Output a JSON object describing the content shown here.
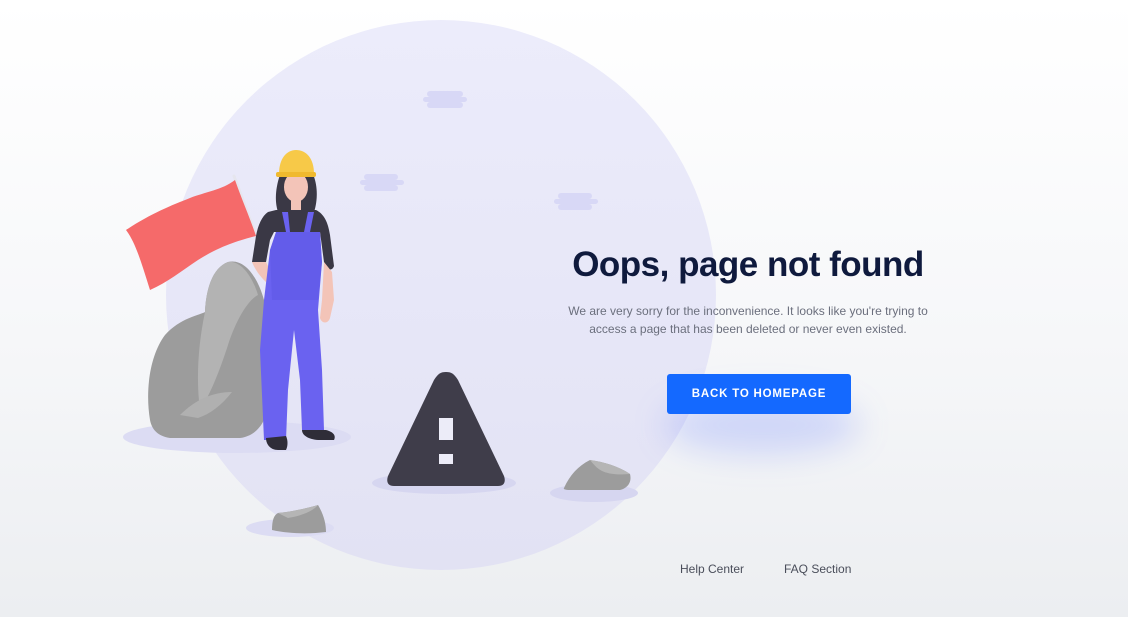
{
  "page": {
    "title": "Oops, page not found",
    "description": "We are very sorry for the inconvenience. It looks like you're trying to access a page that has been deleted or never even existed.",
    "cta_label": "BACK TO HOMEPAGE"
  },
  "footer": {
    "links": [
      "Help Center",
      "FAQ Section"
    ]
  },
  "colors": {
    "accent": "#1469ff",
    "title": "#0f1a3d",
    "flag": "#f56a6a",
    "overalls": "#6a62f0",
    "helmet": "#f7c948",
    "warning_sign": "#3f3d4a"
  },
  "icons": [
    "warning-triangle-icon"
  ]
}
